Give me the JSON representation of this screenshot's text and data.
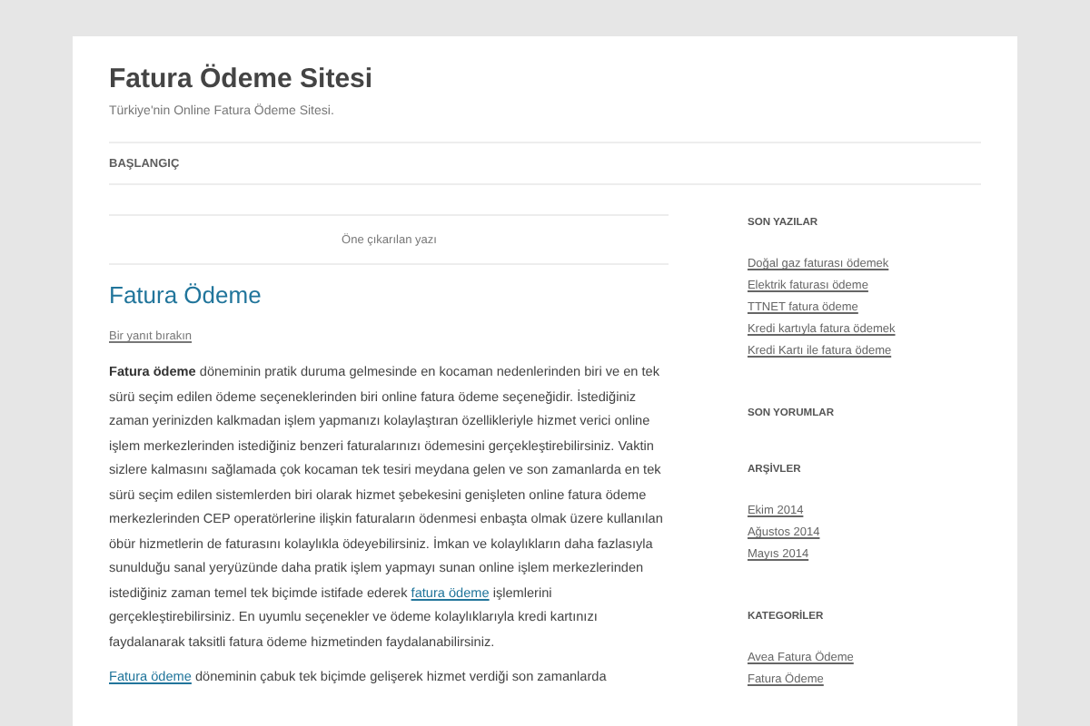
{
  "site": {
    "title": "Fatura Ödeme Sitesi",
    "tagline": "Türkiye'nin Online Fatura Ödeme Sitesi."
  },
  "nav": [
    {
      "label": "BAŞLANGIÇ",
      "selected": false
    }
  ],
  "featured_label": "Öne çıkarılan yazı",
  "post": {
    "title": "Fatura Ödeme",
    "reply_link": "Bir yanıt bırakın",
    "paragraphs": [
      [
        {
          "kind": "text",
          "text": "**Fatura ödeme** döneminin pratik duruma gelmesinde en kocaman nedenlerinden biri ve en tek sürü seçim edilen ödeme seçeneklerinden biri online fatura ödeme seçeneğidir. İstediğiniz zaman yerinizden kalkmadan işlem yapmanızı kolaylaştıran özellikleriyle hizmet verici online işlem merkezlerinden istediğiniz benzeri faturalarınızı ödemesini gerçekleştirebilirsiniz. Vaktin sizlere kalmasını sağlamada çok kocaman tek tesiri meydana gelen ve son zamanlarda en tek sürü seçim edilen sistemlerden biri olarak hizmet şebekesini genişleten online fatura ödeme merkezlerinden CEP operatörlerine ilişkin faturaların ödenmesi enbaşta olmak üzere kullanılan öbür hizmetlerin de faturasını kolaylıkla ödeyebilirsiniz. İmkan ve kolaylıkların daha fazlasıyla sunulduğu sanal yeryüzünde daha pratik işlem yapmayı sunan online işlem merkezlerinden istediğiniz zaman temel tek biçimde istifade ederek "
        },
        {
          "kind": "link",
          "text": "fatura ödeme"
        },
        {
          "kind": "text",
          "text": " işlemlerini gerçekleştirebilirsiniz. En uyumlu seçenekler ve ödeme kolaylıklarıyla kredi kartınızı faydalanarak taksitli fatura ödeme hizmetinden faydalanabilirsiniz."
        }
      ],
      [
        {
          "kind": "link",
          "text": "Fatura ödeme"
        },
        {
          "kind": "text",
          "text": " döneminin çabuk tek biçimde gelişerek hizmet verdiği son zamanlarda"
        }
      ]
    ]
  },
  "sidebar": [
    {
      "title": "SON YAZILAR",
      "items": [
        "Doğal gaz faturası ödemek",
        "Elektrik faturası ödeme",
        "TTNET fatura ödeme",
        "Kredi kartıyla fatura ödemek",
        "Kredi Kartı ile fatura ödeme"
      ]
    },
    {
      "title": "SON YORUMLAR"
    },
    {
      "title": "ARŞİVLER",
      "items": [
        "Ekim 2014",
        "Ağustos 2014",
        "Mayıs 2014"
      ]
    },
    {
      "title": "KATEGORİLER",
      "items": [
        "Avea Fatura Ödeme",
        "Fatura Ödeme"
      ]
    }
  ]
}
